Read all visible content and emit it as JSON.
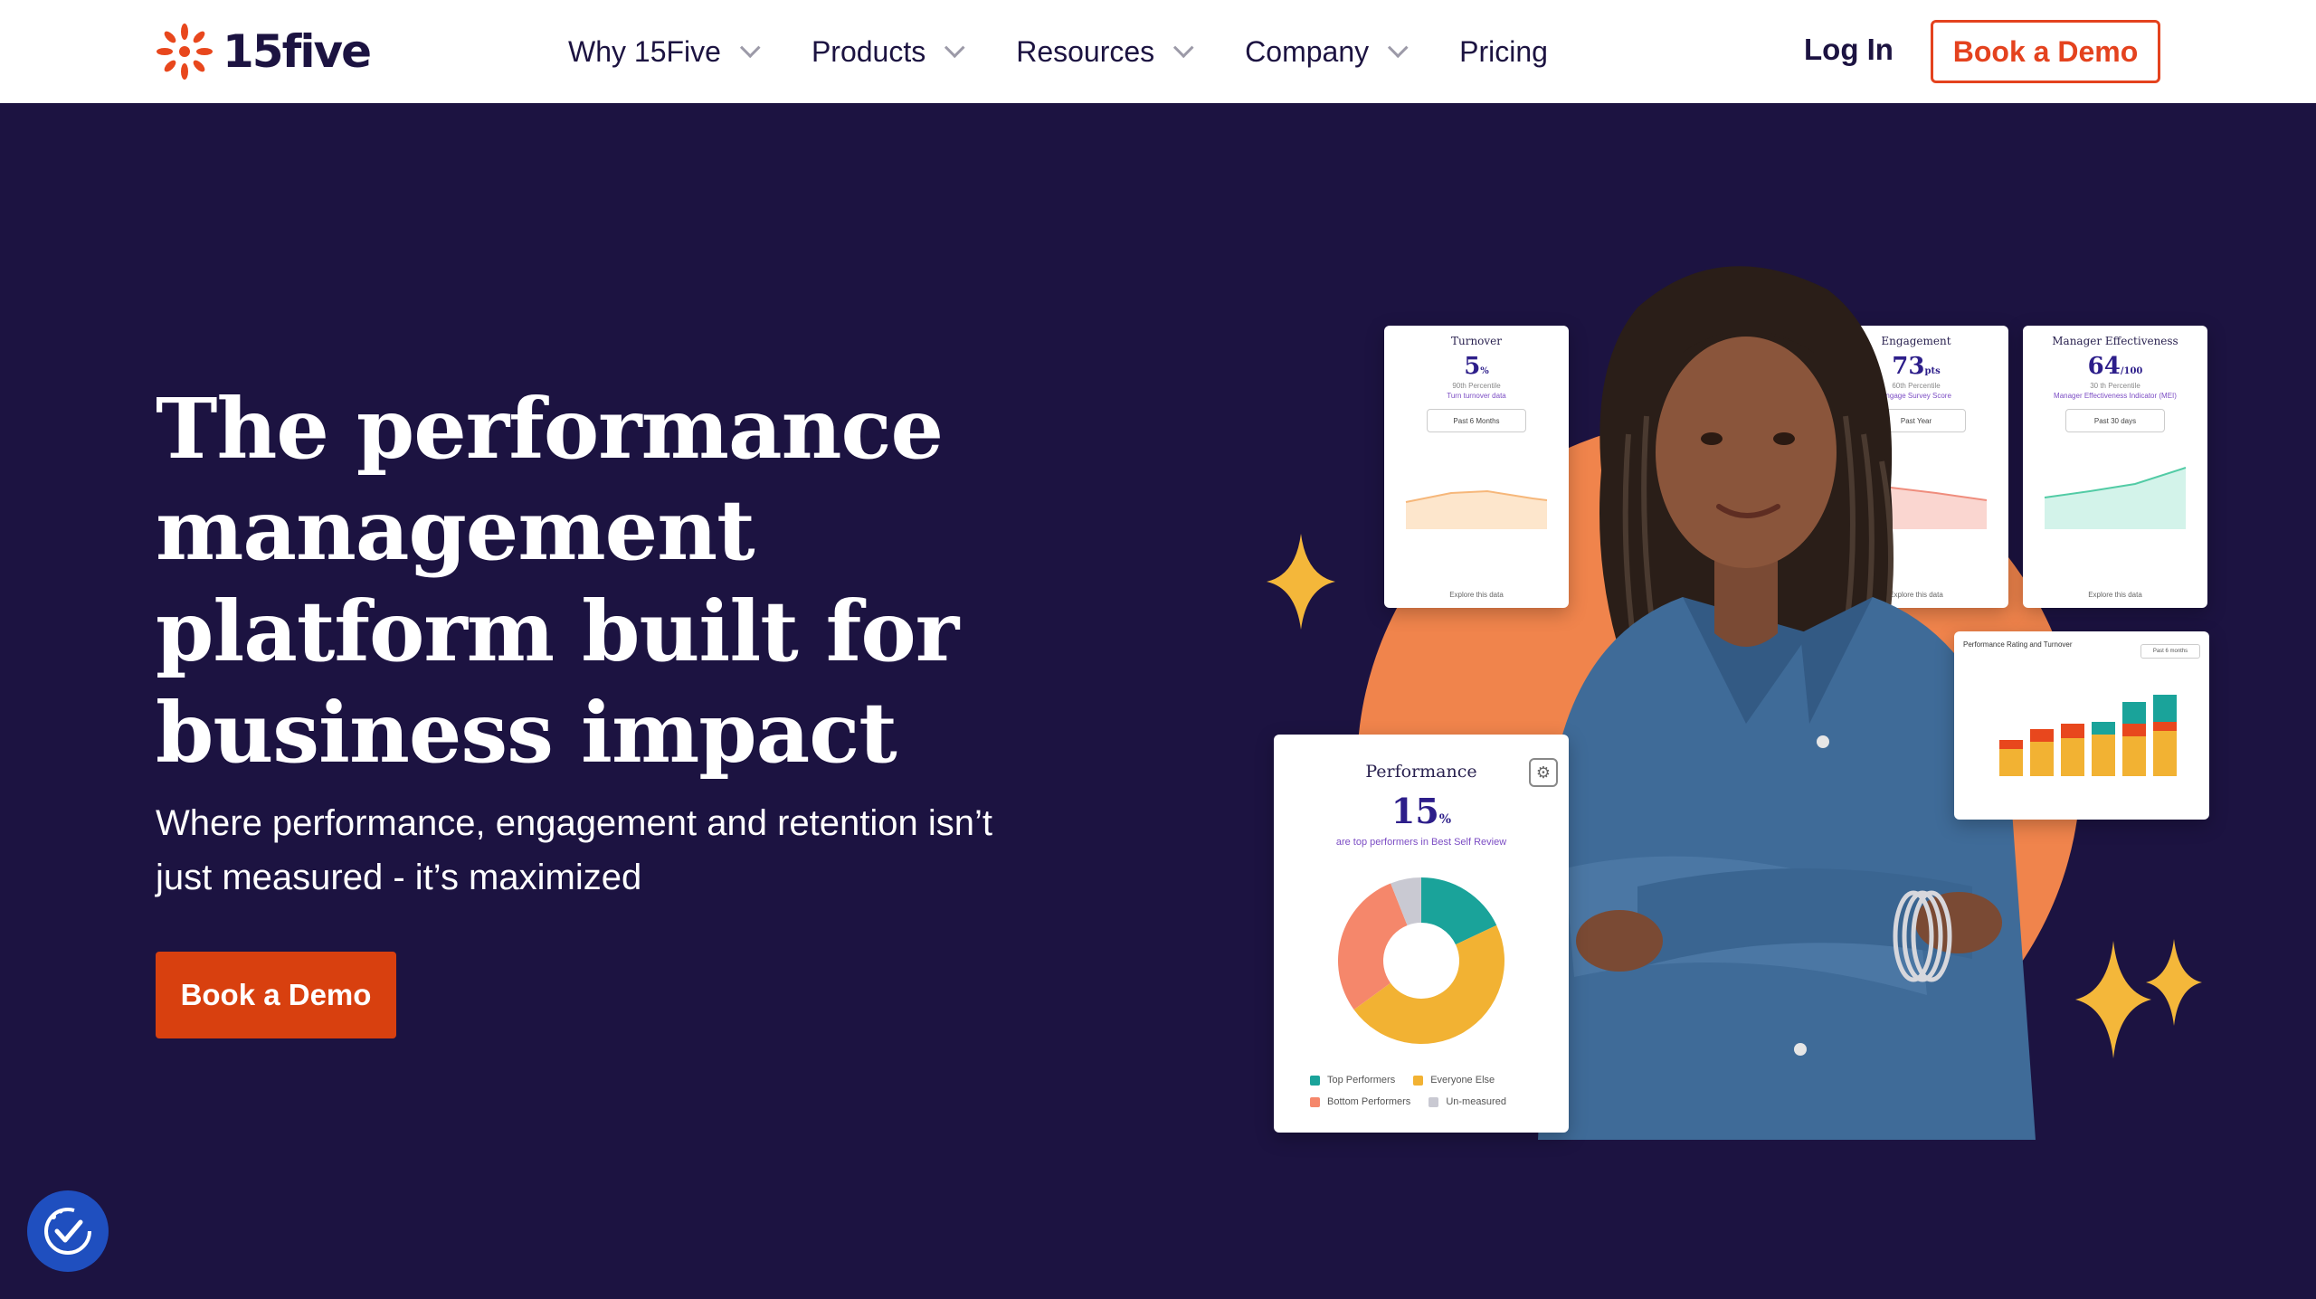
{
  "nav": {
    "logo_text": "15five",
    "items": [
      {
        "label": "Why 15Five",
        "has_dropdown": true
      },
      {
        "label": "Products",
        "has_dropdown": true
      },
      {
        "label": "Resources",
        "has_dropdown": true
      },
      {
        "label": "Company",
        "has_dropdown": true
      },
      {
        "label": "Pricing",
        "has_dropdown": false
      }
    ],
    "login": "Log In",
    "book_demo": "Book a Demo"
  },
  "hero": {
    "headline": "The performance management platform built for business impact",
    "subhead": "Where performance, engagement and retention isn’t just measured - it’s maximized",
    "cta": "Book a Demo"
  },
  "cards": {
    "turnover": {
      "title": "Turnover",
      "value": "5",
      "unit": "%",
      "sub": "90th Percentile",
      "link": "Turn turnover data",
      "pill": "Past 6 Months",
      "foot": "Explore this data"
    },
    "engagement": {
      "title": "Engagement",
      "value": "73",
      "unit": "pts",
      "sub": "60th Percentile",
      "link": "Engage Survey Score",
      "pill": "Past Year",
      "foot": "Explore this data"
    },
    "manager": {
      "title": "Manager Effectiveness",
      "value": "64",
      "unit": "/100",
      "sub": "30 th Percentile",
      "link": "Manager Effectiveness Indicator (MEI)",
      "pill": "Past 30 days",
      "foot": "Explore this data"
    },
    "performance": {
      "title": "Performance",
      "value": "15",
      "unit": "%",
      "link": "are top performers in Best Self Review",
      "legend": [
        {
          "label": "Top Performers",
          "color": "#1aa39a"
        },
        {
          "label": "Everyone Else",
          "color": "#f2b233"
        },
        {
          "label": "Bottom Performers",
          "color": "#f5876b"
        },
        {
          "label": "Un-measured",
          "color": "#c9c9d2"
        }
      ],
      "donut": [
        {
          "label": "Top Performers",
          "value": 18,
          "color": "#1aa39a"
        },
        {
          "label": "Everyone Else",
          "value": 47,
          "color": "#f2b233"
        },
        {
          "label": "Bottom Performers",
          "value": 29,
          "color": "#f5876b"
        },
        {
          "label": "Un-measured",
          "value": 6,
          "color": "#c9c9d2"
        }
      ]
    },
    "rating": {
      "title": "Performance Rating and Turnover",
      "pill": "Past 6 months"
    }
  },
  "colors": {
    "navy": "#1c1341",
    "orange": "#e4421e",
    "circle": "#f0844c",
    "star": "#f4b73a"
  }
}
